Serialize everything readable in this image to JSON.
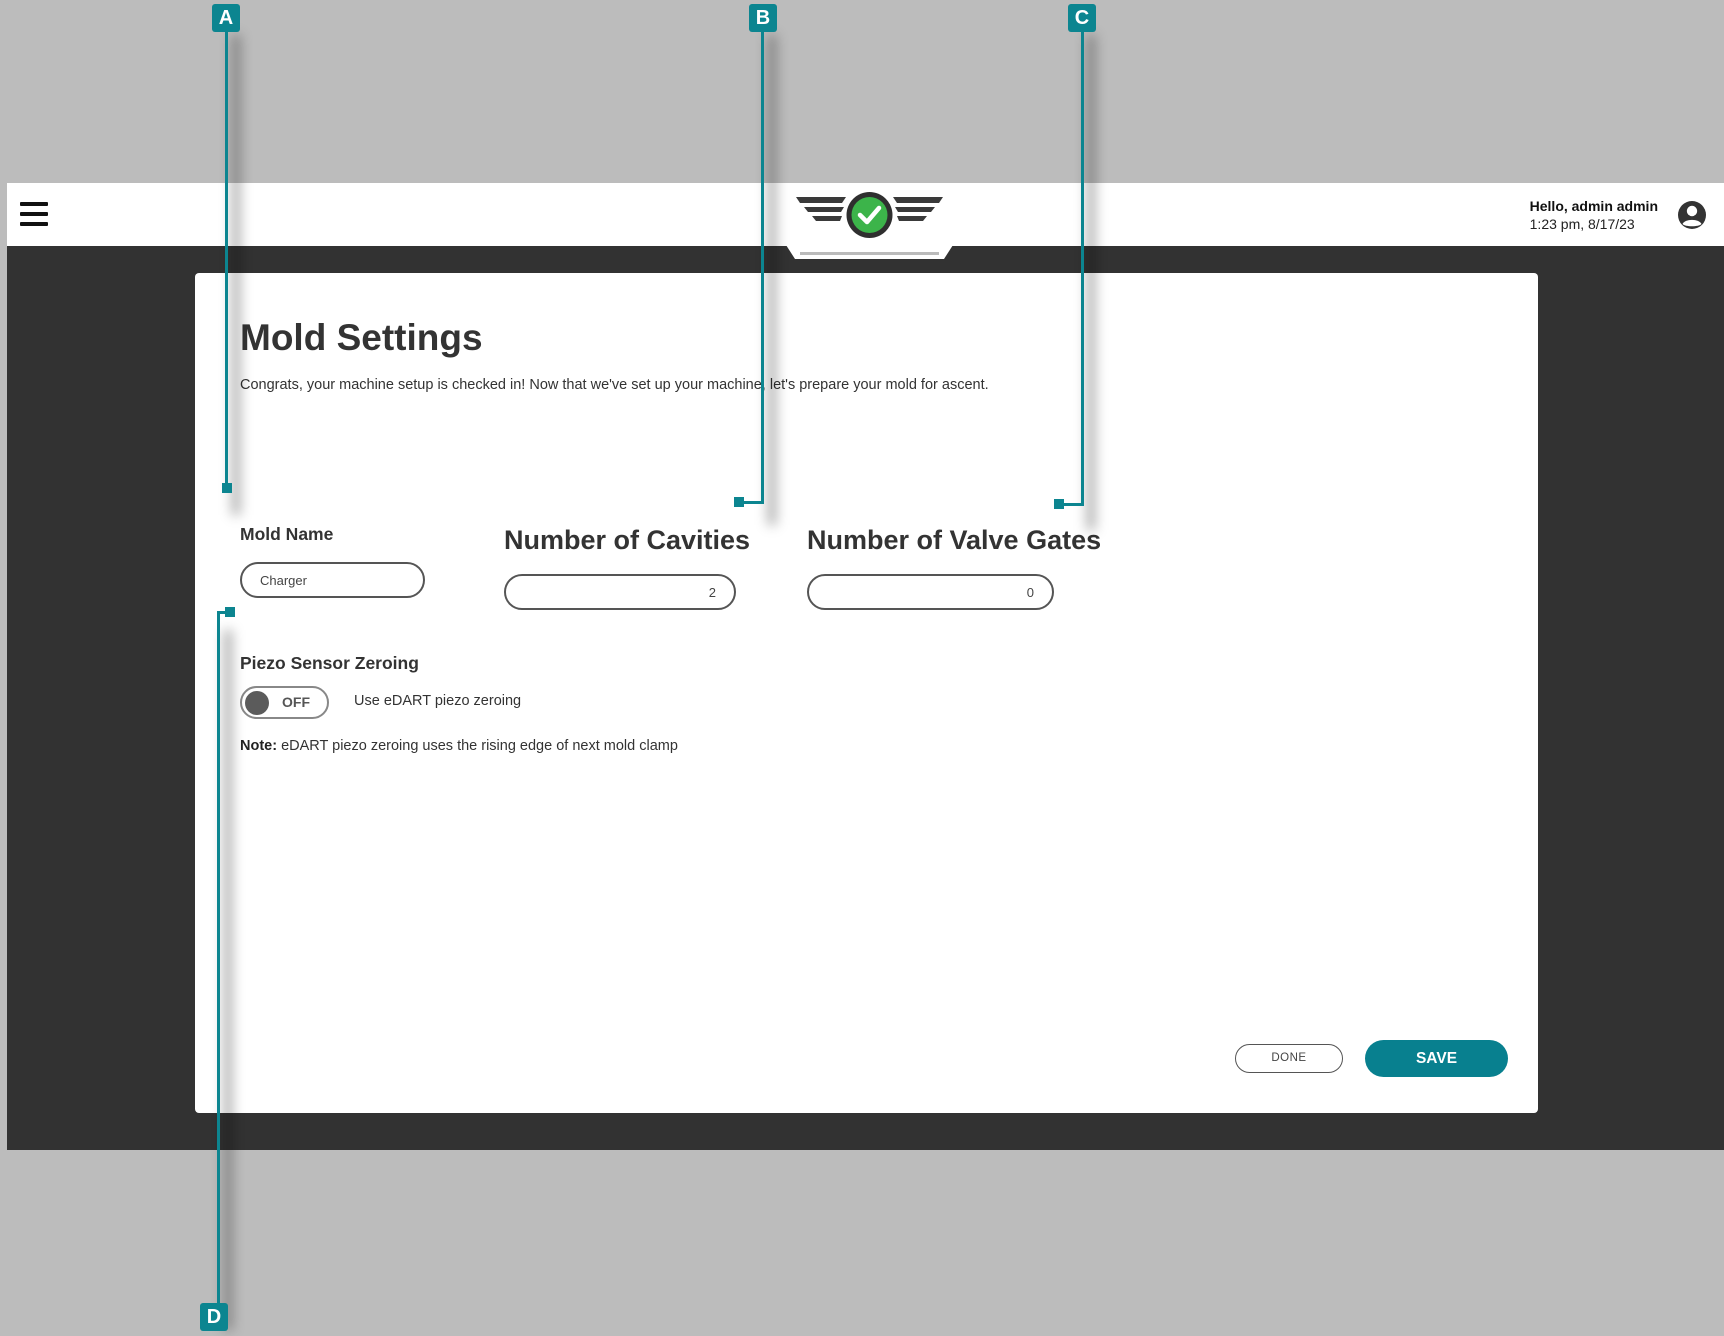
{
  "header": {
    "greeting": "Hello, admin admin",
    "timestamp": "1:23 pm, 8/17/23",
    "logo_icon": "check-wings-logo",
    "menu_icon": "hamburger-menu-icon",
    "user_icon": "user-circle-icon"
  },
  "page": {
    "title": "Mold Settings",
    "subtitle": "Congrats, your machine setup is checked in! Now that we've set up your machine, let's prepare your mold for ascent."
  },
  "fields": {
    "mold_name": {
      "label": "Mold Name",
      "value": "Charger"
    },
    "cavities": {
      "label": "Number of Cavities",
      "value": "2"
    },
    "valve_gates": {
      "label": "Number of Valve Gates",
      "value": "0"
    }
  },
  "piezo": {
    "label": "Piezo Sensor Zeroing",
    "toggle_state": "OFF",
    "toggle_description": "Use eDART piezo zeroing",
    "note_prefix": "Note:",
    "note_text": " eDART piezo zeroing uses the rising edge of next mold clamp"
  },
  "actions": {
    "done_label": "DONE",
    "save_label": "SAVE"
  },
  "callouts": [
    "A",
    "B",
    "C",
    "D"
  ],
  "colors": {
    "accent": "#0c8590",
    "success": "#3cb44a",
    "app_background": "#323232",
    "outer_background": "#bcbcbc"
  }
}
